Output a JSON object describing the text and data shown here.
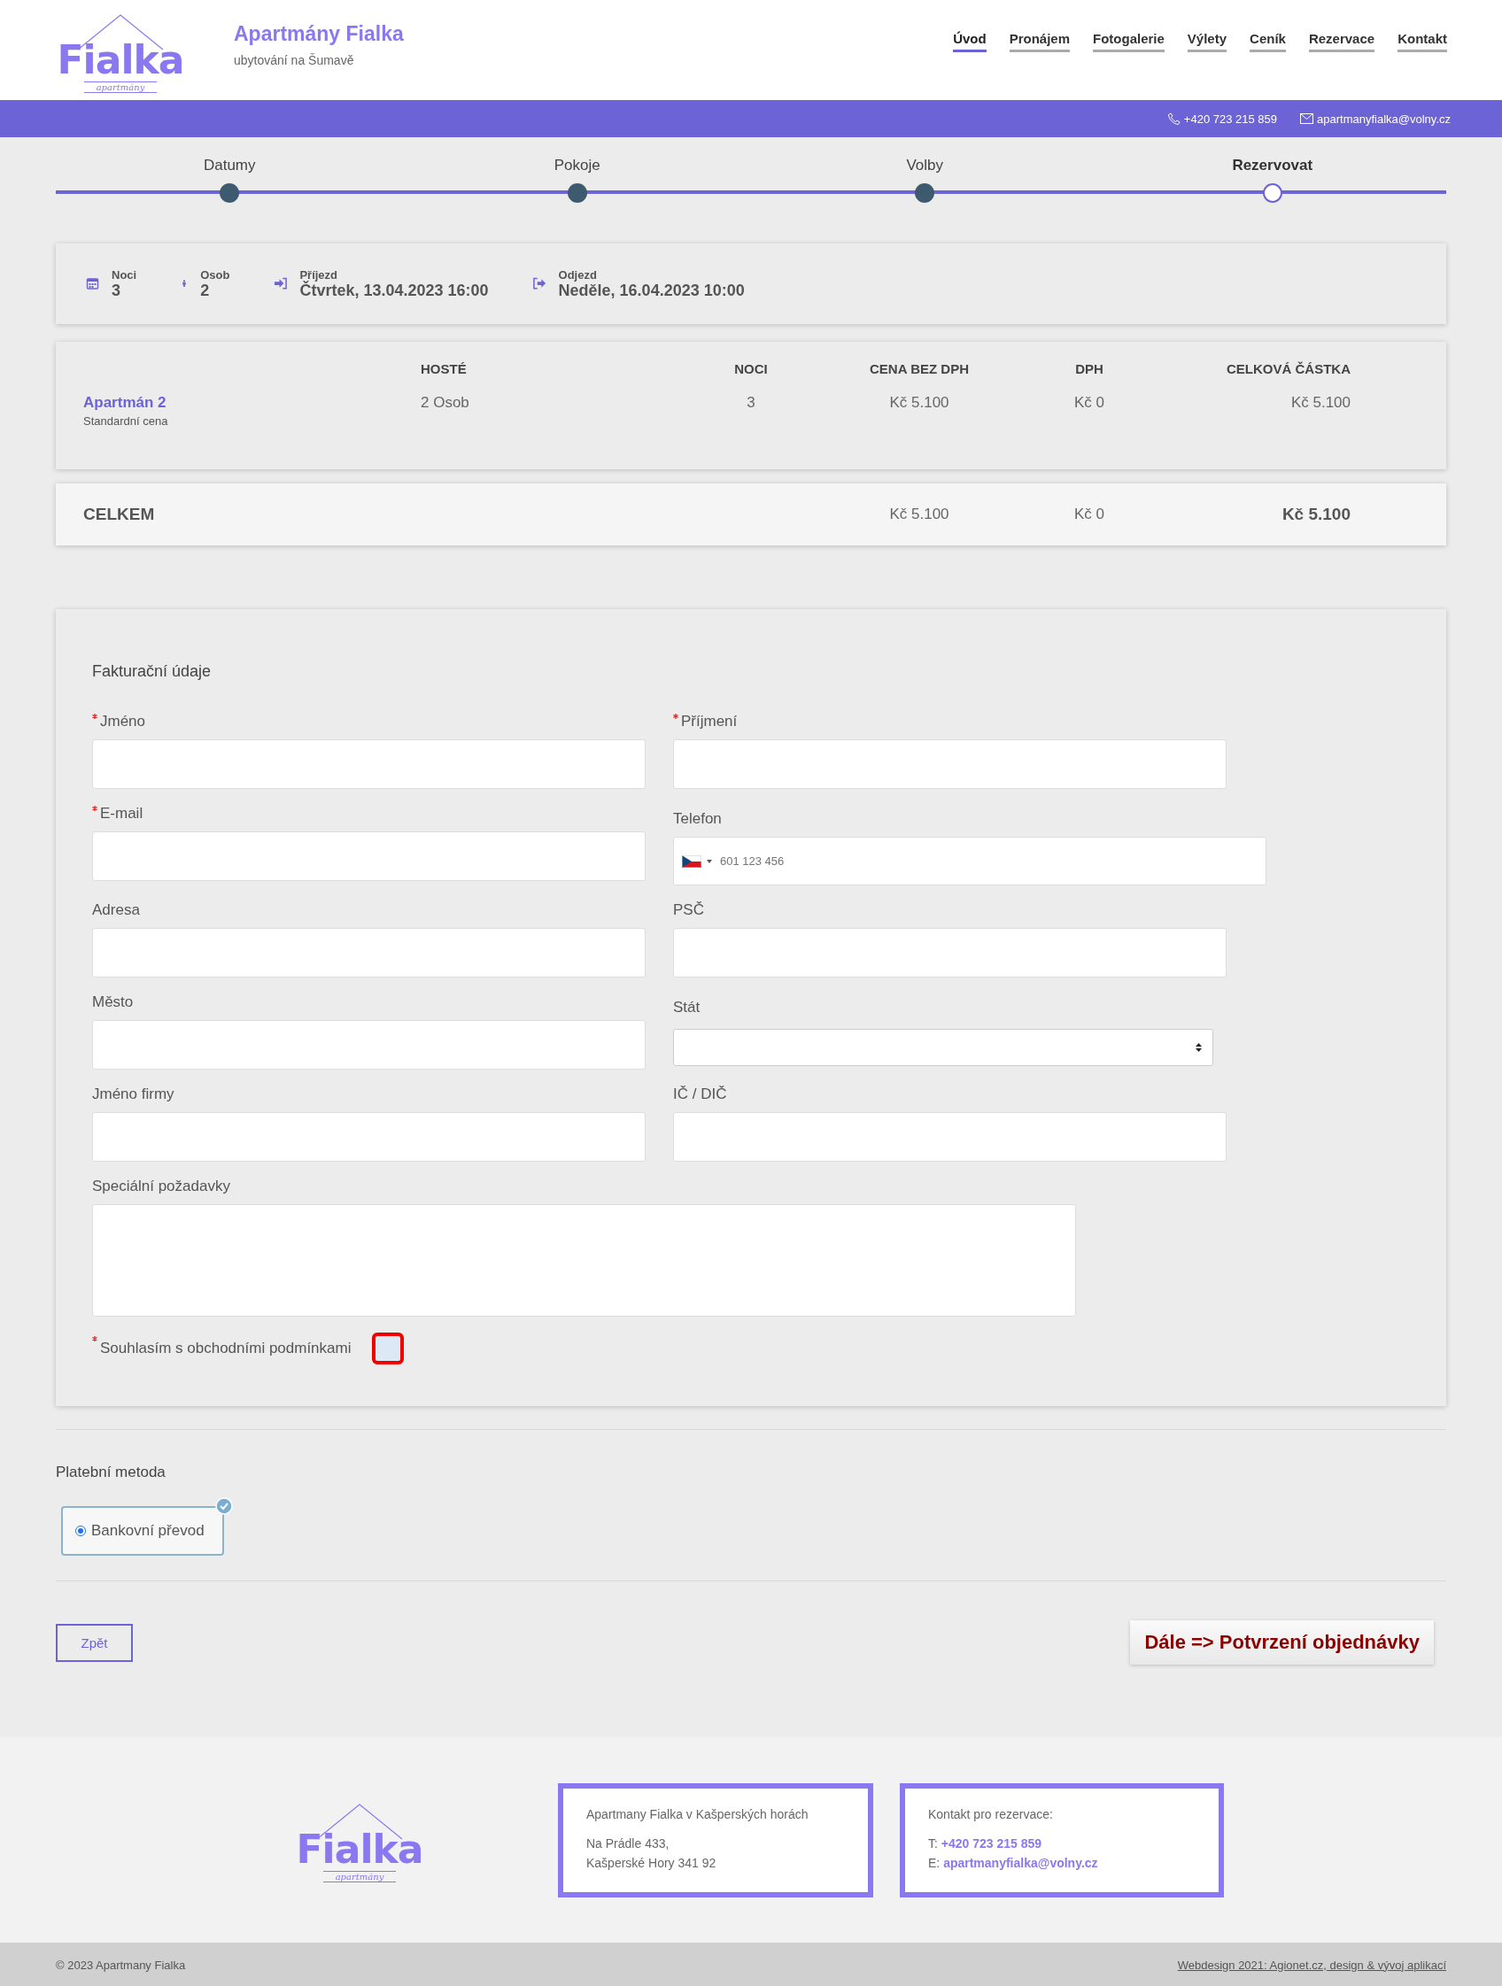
{
  "logo": {
    "word": "Fialka",
    "tagline": "apartmány"
  },
  "footer_logo": {
    "word": "Fialka",
    "tagline": "apartmány"
  },
  "site": {
    "title": "Apartmány Fialka",
    "subtitle": "ubytování na Šumavě"
  },
  "nav": [
    {
      "label": "Úvod",
      "selected": true
    },
    {
      "label": "Pronájem",
      "selected": false
    },
    {
      "label": "Fotogalerie",
      "selected": false
    },
    {
      "label": "Výlety",
      "selected": false
    },
    {
      "label": "Ceník",
      "selected": false
    },
    {
      "label": "Rezervace",
      "selected": false
    },
    {
      "label": "Kontakt",
      "selected": false
    }
  ],
  "contact_bar": {
    "phone": "+420 723 215 859",
    "email": "apartmanyfialka@volny.cz"
  },
  "steps": [
    {
      "label": "Datumy",
      "selected": false
    },
    {
      "label": "Pokoje",
      "selected": false
    },
    {
      "label": "Volby",
      "selected": false
    },
    {
      "label": "Rezervovat",
      "selected": true
    }
  ],
  "summary": [
    {
      "kind": "nights",
      "label": "Noci",
      "value": "3"
    },
    {
      "kind": "persons",
      "label": "Osob",
      "value": "2"
    },
    {
      "kind": "arrival",
      "label": "Příjezd",
      "value": "Čtvrtek, 13.04.2023 16:00"
    },
    {
      "kind": "departure",
      "label": "Odjezd",
      "value": "Neděle, 16.04.2023 10:00"
    }
  ],
  "table": {
    "columns": [
      "HOSTÉ",
      "NOCI",
      "CENA BEZ DPH",
      "DPH",
      "CELKOVÁ ČÁSTKA"
    ],
    "rows": [
      {
        "name": "Apartmán 2",
        "rate": "Standardní cena",
        "cells": [
          "2 Osob",
          "3",
          "Kč 5.100",
          "Kč 0",
          "Kč 5.100"
        ]
      }
    ],
    "total": {
      "label": "CELKEM",
      "cells": [
        "Kč 5.100",
        "Kč 0",
        "Kč 5.100"
      ]
    }
  },
  "billing": {
    "title": "Fakturační údaje",
    "fields": [
      {
        "label": "Jméno",
        "required": true,
        "kind": "text"
      },
      {
        "label": "Příjmení",
        "required": true,
        "kind": "text"
      },
      {
        "label": "E-mail",
        "required": true,
        "kind": "text"
      },
      {
        "label": "Telefon",
        "required": false,
        "kind": "tel",
        "placeholder": "601 123 456"
      },
      {
        "label": "Adresa",
        "required": false,
        "kind": "text"
      },
      {
        "label": "PSČ",
        "required": false,
        "kind": "text"
      },
      {
        "label": "Město",
        "required": false,
        "kind": "text"
      },
      {
        "label": "Stát",
        "required": false,
        "kind": "select"
      },
      {
        "label": "Jméno firmy",
        "required": false,
        "kind": "text"
      },
      {
        "label": "IČ / DIČ",
        "required": false,
        "kind": "text"
      },
      {
        "label": "Speciální požadavky",
        "required": false,
        "kind": "textarea"
      }
    ],
    "terms": {
      "label": "Souhlasím s obchodními podmínkami",
      "required": true,
      "checked": false
    }
  },
  "payment": {
    "title": "Platební metoda",
    "options": [
      {
        "label": "Bankovní převod",
        "selected": true
      }
    ]
  },
  "buttons": {
    "back": "Zpět",
    "next": "Dále => Potvrzení objednávky"
  },
  "footer": {
    "address": {
      "title": "Apartmany Fialka v Kašperských horách",
      "lines": [
        "Na Prádle 433,",
        "Kašperské Hory 341 92"
      ]
    },
    "contact": {
      "title": "Kontakt pro rezervace:",
      "phone_label": "T:",
      "phone": "+420 723 215 859",
      "email_label": "E:",
      "email": "apartmanyfialka@volny.cz"
    },
    "copyright": "© 2023 Apartmany Fialka",
    "credit": "Webdesign 2021: Agionet.cz, design & vývoj aplikací"
  }
}
